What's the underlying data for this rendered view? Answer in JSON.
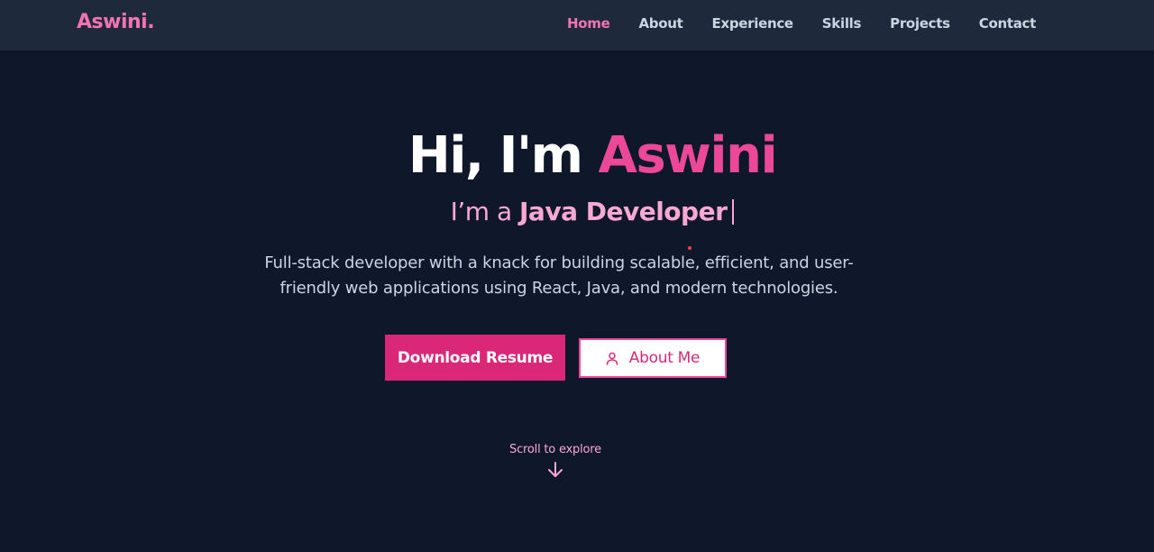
{
  "brand": "Aswini.",
  "nav": [
    {
      "label": "Home",
      "active": true
    },
    {
      "label": "About"
    },
    {
      "label": "Experience"
    },
    {
      "label": "Skills"
    },
    {
      "label": "Projects"
    },
    {
      "label": "Contact"
    }
  ],
  "hero": {
    "greeting": "Hi, I'm ",
    "name": "Aswini",
    "subtitle_prefix": "I’m a ",
    "role": "Java Developer",
    "description": "Full-stack developer with a knack for building scalable, efficient, and user-friendly web applications using React, Java, and modern technologies.",
    "primary_button": "Download Resume",
    "secondary_button": "About Me",
    "secondary_icon": "user-icon",
    "scroll_text": "Scroll to explore",
    "scroll_icon": "arrow-down-icon"
  },
  "colors": {
    "background": "#0f172a",
    "navbar": "#1e293b",
    "accent": "#ec4899",
    "accent_dark": "#db2777",
    "accent_light": "#f9a8d4"
  }
}
